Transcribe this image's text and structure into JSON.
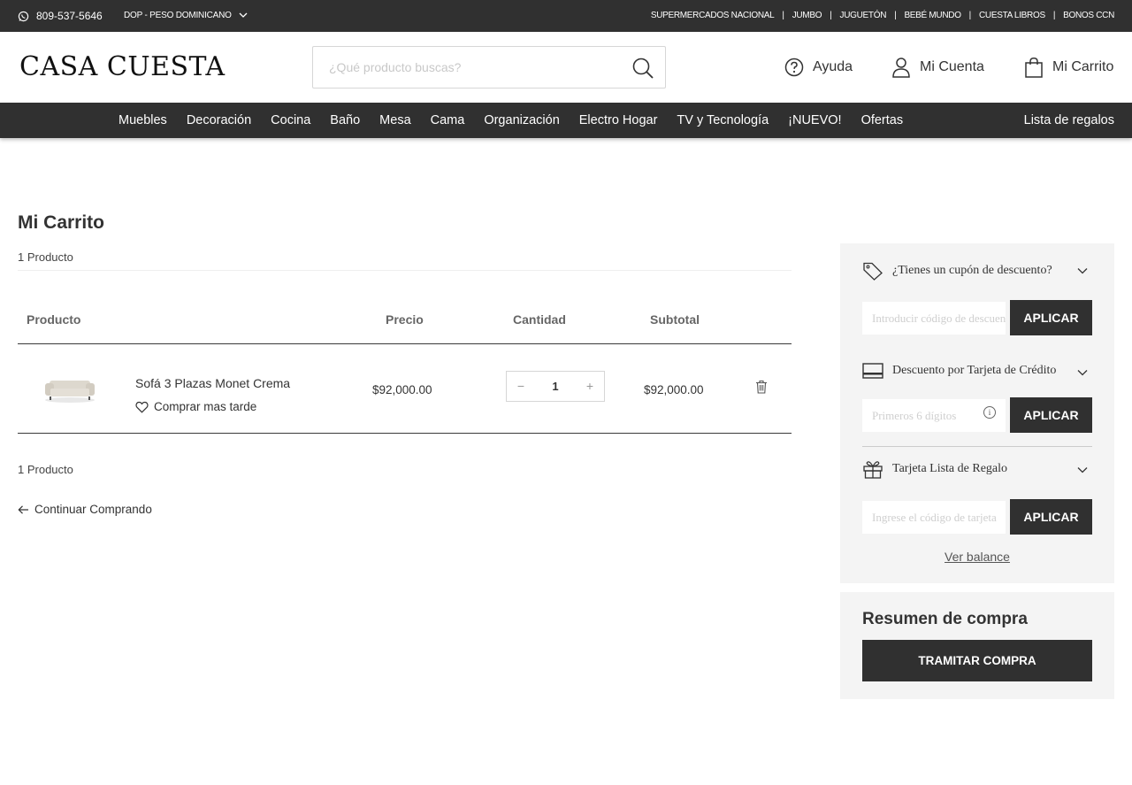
{
  "topbar": {
    "phone": "809-537-5646",
    "currency": "DOP - PESO DOMINICANO",
    "links": [
      "SUPERMERCADOS NACIONAL",
      "JUMBO",
      "JUGUETÓN",
      "BEBÉ MUNDO",
      "CUESTA LIBROS",
      "BONOS CCN"
    ]
  },
  "header": {
    "logo": "CASA CUESTA",
    "search_placeholder": "¿Qué producto buscas?",
    "help": "Ayuda",
    "account": "Mi Cuenta",
    "cart": "Mi Carrito"
  },
  "nav": {
    "items": [
      "Muebles",
      "Decoración",
      "Cocina",
      "Baño",
      "Mesa",
      "Cama",
      "Organización",
      "Electro Hogar",
      "TV y Tecnología",
      "¡NUEVO!",
      "Ofertas"
    ],
    "gift_list": "Lista de regalos"
  },
  "cart": {
    "title": "Mi Carrito",
    "count_label": "1 Producto",
    "columns": {
      "product": "Producto",
      "price": "Precio",
      "quantity": "Cantidad",
      "subtotal": "Subtotal"
    },
    "items": [
      {
        "name": "Sofá 3 Plazas Monet Crema",
        "save_later": "Comprar mas tarde",
        "price": "$92,000.00",
        "quantity": "1",
        "subtotal": "$92,000.00"
      }
    ],
    "qty_minus": "−",
    "qty_plus": "+",
    "continue": "Continuar Comprando"
  },
  "sidebar": {
    "coupon": {
      "title": "¿Tienes un cupón de descuento?",
      "placeholder": "Introducir código de descuento",
      "button": "APLICAR"
    },
    "credit": {
      "title": "Descuento por Tarjeta de Crédito",
      "placeholder": "Primeros 6 dígitos",
      "info": "i",
      "button": "APLICAR"
    },
    "giftcard": {
      "title": "Tarjeta Lista de Regalo",
      "placeholder": "Ingrese el código de tarjeta",
      "button": "APLICAR"
    },
    "balance": "Ver balance"
  },
  "summary": {
    "title": "Resumen de compra",
    "checkout": "TRAMITAR COMPRA"
  },
  "colors": {
    "dark": "#303030",
    "panel": "#f4f4f4"
  }
}
